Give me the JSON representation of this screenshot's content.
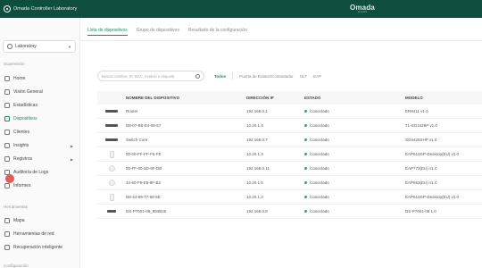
{
  "window": {
    "title": "Omada Controller Laboratory"
  },
  "brand": {
    "name": "Omada",
    "sub": "by tp-link"
  },
  "sidebar": {
    "site": "Laboratory",
    "sections": {
      "supervision": "Supervisión",
      "tools": "Herramientas",
      "config": "Configuración"
    },
    "items": [
      {
        "label": "Home"
      },
      {
        "label": "Visión General"
      },
      {
        "label": "Estadísticas"
      },
      {
        "label": "Dispositivos"
      },
      {
        "label": "Clientes"
      },
      {
        "label": "Insights"
      },
      {
        "label": "Registros"
      },
      {
        "label": "Auditoría de Logs"
      },
      {
        "label": "Informes"
      }
    ],
    "tools": [
      {
        "label": "Mapa"
      },
      {
        "label": "Herramientas de red"
      },
      {
        "label": "Recuperación inteligente"
      }
    ]
  },
  "tabs": [
    "Lista de dispositivos",
    "Grupo de dispositivos",
    "Resultado de la configuración"
  ],
  "search": {
    "placeholder": "Buscar nombre, IP, MAC, modelo o etiqueta"
  },
  "filters": [
    "Todos",
    "Puerta de Enlace/Conmutador",
    "OLT",
    "EAP"
  ],
  "table": {
    "headers": {
      "name": "NOMBRE DEL DISPOSITIVO",
      "ip": "DIRECCIÓN IP",
      "status": "ESTADO",
      "model": "MODELO"
    },
    "rows": [
      {
        "name": "Router",
        "ip": "192.168.0.1",
        "status": "Conectado",
        "model": "ER8411 v1.0",
        "type": "switch"
      },
      {
        "name": "D8-07-B6-E4-08-57",
        "ip": "10.20.1.4",
        "status": "Conectado",
        "model": "TL-SG2428P v1.0",
        "type": "switch"
      },
      {
        "name": "Switch Core",
        "ip": "192.168.0.7",
        "status": "Conectado",
        "model": "SG6428XHP v1.0",
        "type": "switch"
      },
      {
        "name": "00-00-FF-FF-F5-FE",
        "ip": "10.20.1.3",
        "status": "Conectado",
        "model": "EAP610GP-Desktop(EU) v1.0",
        "type": "wall"
      },
      {
        "name": "00-FF-00-3D-9F-DB",
        "ip": "192.168.0.11",
        "status": "Conectado",
        "model": "EAP773(EU) v1.0",
        "type": "ap"
      },
      {
        "name": "34-60-F9-E5-9F-B2",
        "ip": "10.20.1.5",
        "status": "Conectado",
        "model": "EAP653(EU) v1.0",
        "type": "ap"
      },
      {
        "name": "D8-44-89-77-58-5E",
        "ip": "10.20.1.2",
        "status": "Conectado",
        "model": "EAP610GP-Desktop(EU) v1.0",
        "type": "wall"
      },
      {
        "name": "DS-P7001-08_993B26",
        "ip": "192.168.0.8",
        "status": "Conectado",
        "model": "DS-P7001-08 1.0",
        "type": "switch-small"
      }
    ]
  },
  "colors": {
    "topbar": "#0f4d3f",
    "accent": "#1d8a63",
    "status_ok": "#2fa56f",
    "badge": "#e35b5b"
  }
}
